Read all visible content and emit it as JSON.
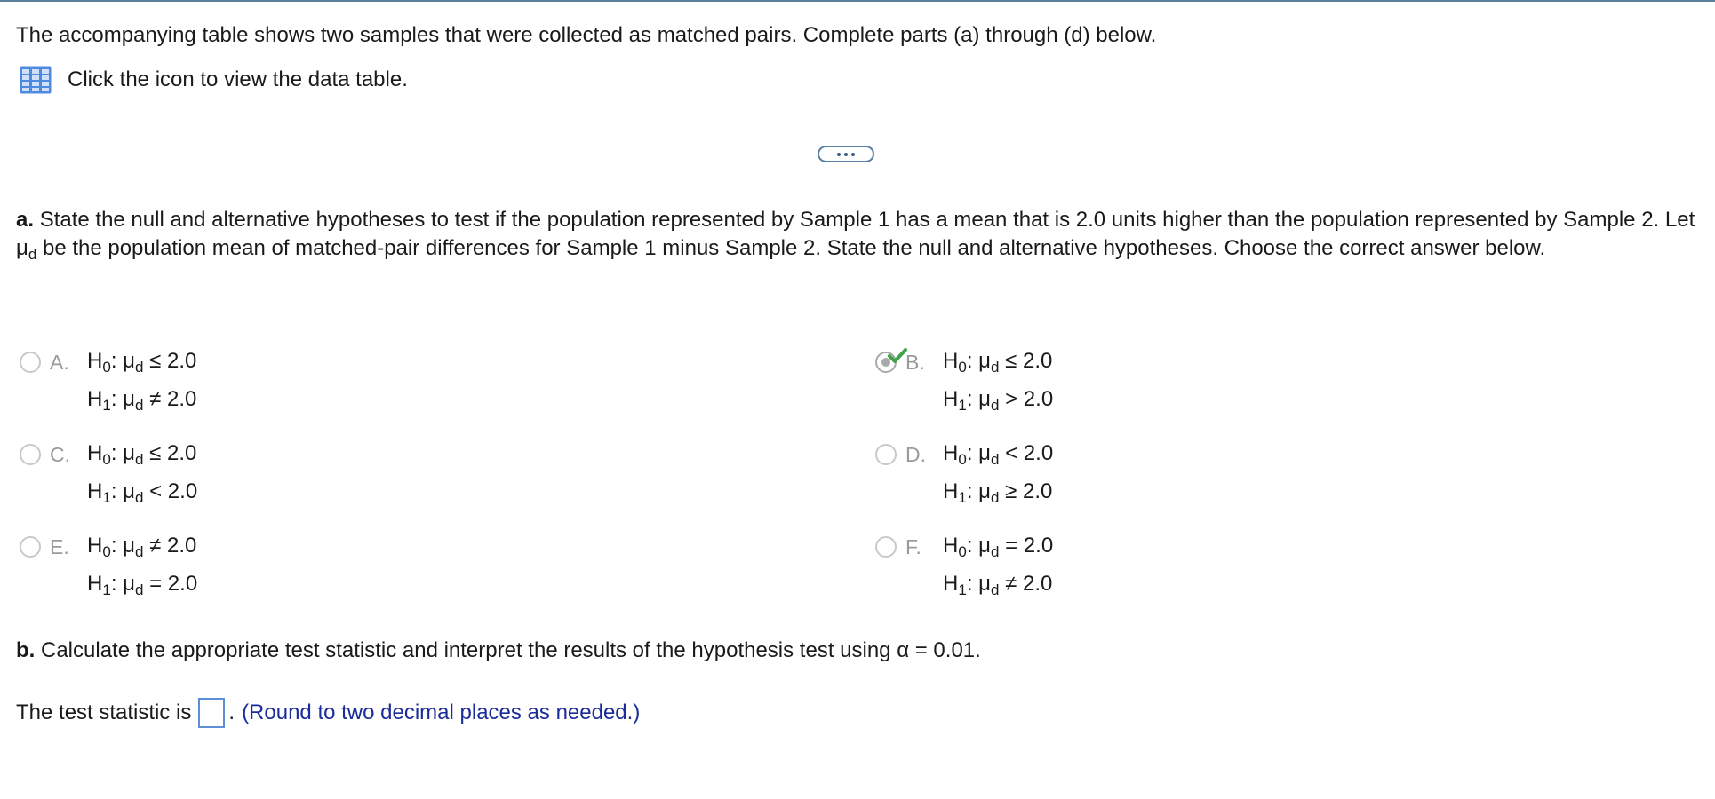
{
  "intro": "The accompanying table shows two samples that were collected as matched pairs. Complete parts (a) through (d) below.",
  "table_link": "Click the icon to view the data table.",
  "part_a": {
    "label": "a.",
    "text_before_sub": "State the null and alternative hypotheses to test if the population represented by Sample 1 has a mean that is 2.0 units higher than the population represented by Sample 2. Let μ",
    "sub": "d",
    "text_after_sub": " be the population mean of matched-pair differences for Sample 1 minus Sample 2. State the null and alternative hypotheses. Choose the correct answer below."
  },
  "options": [
    {
      "letter": "A.",
      "h0": "≤ 2.0",
      "h1": "≠ 2.0",
      "selected": false
    },
    {
      "letter": "B.",
      "h0": "≤ 2.0",
      "h1": "> 2.0",
      "selected": true
    },
    {
      "letter": "C.",
      "h0": "≤ 2.0",
      "h1": "< 2.0",
      "selected": false
    },
    {
      "letter": "D.",
      "h0": "< 2.0",
      "h1": "≥ 2.0",
      "selected": false
    },
    {
      "letter": "E.",
      "h0": "≠ 2.0",
      "h1": "= 2.0",
      "selected": false
    },
    {
      "letter": "F.",
      "h0": "= 2.0",
      "h1": "≠ 2.0",
      "selected": false
    }
  ],
  "hypothesis_symbols": {
    "h": "H",
    "zero": "0",
    "one": "1",
    "mu": ": μ",
    "d": "d"
  },
  "part_b": {
    "label": "b.",
    "text": "Calculate the appropriate test statistic and interpret the results of the hypothesis test using α = 0.01."
  },
  "answer": {
    "prefix": "The test statistic is",
    "suffix": ".",
    "hint": "(Round to two decimal places as needed.)",
    "value": ""
  },
  "colors": {
    "accent": "#5b8fd6",
    "check": "#3ea34a",
    "hint": "#1a2b9a"
  }
}
